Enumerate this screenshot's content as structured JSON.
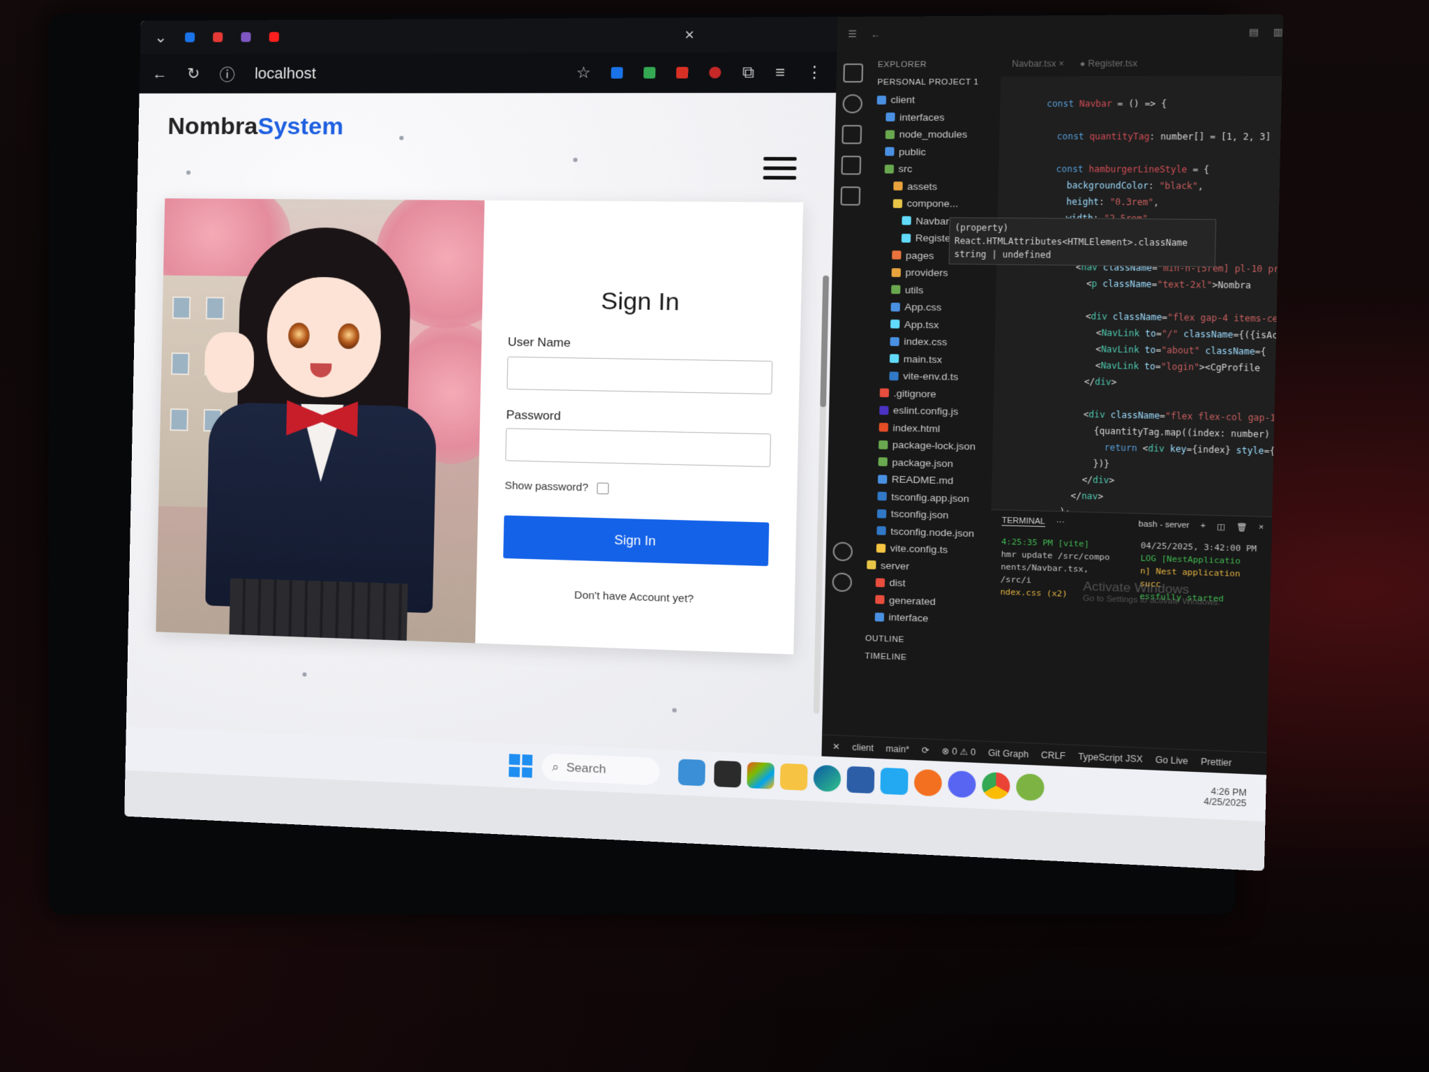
{
  "browser": {
    "url": "localhost",
    "tab_close": "×"
  },
  "site": {
    "brand_main": "Nombra",
    "brand_accent": "System",
    "accent_color": "#1d5fe0"
  },
  "signin": {
    "title": "Sign In",
    "username_label": "User Name",
    "username_value": "",
    "password_label": "Password",
    "password_value": "",
    "show_password_label": "Show password?",
    "show_password_checked": false,
    "submit_label": "Sign In",
    "submit_color": "#1462e8",
    "account_link": "Don't have Account yet?"
  },
  "vscode": {
    "explorer_title": "EXPLORER",
    "project_name": "PERSONAL PROJECT 1",
    "tree": [
      {
        "label": "client",
        "depth": 0,
        "icon": "folder-icon",
        "color": "#4a90e2"
      },
      {
        "label": "interfaces",
        "depth": 1,
        "icon": "folder-icon",
        "color": "#4a90e2"
      },
      {
        "label": "node_modules",
        "depth": 1,
        "icon": "folder-icon",
        "color": "#6aa84f"
      },
      {
        "label": "public",
        "depth": 1,
        "icon": "folder-icon",
        "color": "#4a90e2"
      },
      {
        "label": "src",
        "depth": 1,
        "icon": "folder-icon",
        "color": "#6aa84f"
      },
      {
        "label": "assets",
        "depth": 2,
        "icon": "folder-icon",
        "color": "#e8a33d"
      },
      {
        "label": "compone...",
        "depth": 2,
        "icon": "folder-icon",
        "color": "#e8c547"
      },
      {
        "label": "Navbar...",
        "depth": 3,
        "icon": "react-icon",
        "color": "#61dafb"
      },
      {
        "label": "Register.tsx",
        "depth": 3,
        "icon": "react-icon",
        "color": "#61dafb"
      },
      {
        "label": "pages",
        "depth": 2,
        "icon": "folder-icon",
        "color": "#e8733d"
      },
      {
        "label": "providers",
        "depth": 2,
        "icon": "folder-icon",
        "color": "#e8a33d"
      },
      {
        "label": "utils",
        "depth": 2,
        "icon": "folder-icon",
        "color": "#6aa84f"
      },
      {
        "label": "App.css",
        "depth": 2,
        "icon": "css-icon",
        "color": "#4a90e2"
      },
      {
        "label": "App.tsx",
        "depth": 2,
        "icon": "react-icon",
        "color": "#61dafb"
      },
      {
        "label": "index.css",
        "depth": 2,
        "icon": "css-icon",
        "color": "#4a90e2"
      },
      {
        "label": "main.tsx",
        "depth": 2,
        "icon": "react-icon",
        "color": "#61dafb"
      },
      {
        "label": "vite-env.d.ts",
        "depth": 2,
        "icon": "ts-icon",
        "color": "#3178c6"
      },
      {
        "label": ".gitignore",
        "depth": 1,
        "icon": "git-icon",
        "color": "#e84d3d"
      },
      {
        "label": "eslint.config.js",
        "depth": 1,
        "icon": "eslint-icon",
        "color": "#4b32c3"
      },
      {
        "label": "index.html",
        "depth": 1,
        "icon": "html-icon",
        "color": "#e44d26"
      },
      {
        "label": "package-lock.json",
        "depth": 1,
        "icon": "npm-icon",
        "color": "#6aa84f"
      },
      {
        "label": "package.json",
        "depth": 1,
        "icon": "npm-icon",
        "color": "#6aa84f"
      },
      {
        "label": "README.md",
        "depth": 1,
        "icon": "info-icon",
        "color": "#4a90e2"
      },
      {
        "label": "tsconfig.app.json",
        "depth": 1,
        "icon": "ts-icon",
        "color": "#3178c6"
      },
      {
        "label": "tsconfig.json",
        "depth": 1,
        "icon": "ts-icon",
        "color": "#3178c6"
      },
      {
        "label": "tsconfig.node.json",
        "depth": 1,
        "icon": "ts-icon",
        "color": "#3178c6"
      },
      {
        "label": "vite.config.ts",
        "depth": 1,
        "icon": "vite-icon",
        "color": "#f5c542"
      },
      {
        "label": "server",
        "depth": 0,
        "icon": "folder-icon",
        "color": "#e8c547"
      },
      {
        "label": "dist",
        "depth": 1,
        "icon": "folder-icon",
        "color": "#e84d3d"
      },
      {
        "label": "generated",
        "depth": 1,
        "icon": "folder-icon",
        "color": "#e84d3d"
      },
      {
        "label": "interface",
        "depth": 1,
        "icon": "folder-icon",
        "color": "#4a90e2"
      }
    ],
    "outline_label": "OUTLINE",
    "timeline_label": "TIMELINE",
    "hover_line1": "(property) React.HTMLAttributes<HTMLElement>.className",
    "hover_line2": "string | undefined",
    "terminal_tab": "TERMINAL",
    "terminal_shell": "bash - server",
    "terminal_line1": "4:25:35 PM [vite]",
    "terminal_line2": "hmr update /src/compo",
    "terminal_line3": "nents/Navbar.tsx, /src/i",
    "terminal_line4": "ndex.css (x2)",
    "terminal_right1": "04/25/2025, 3:42:00 PM",
    "terminal_right2": "LOG [NestApplicatio",
    "terminal_right3": "n] Nest application succ",
    "terminal_right4": "essfully started",
    "watermark_title": "Activate Windows",
    "watermark_sub": "Go to Settings to activate Windows.",
    "status_branch": "main*",
    "status_client": "client",
    "status_errors": "0",
    "status_warnings": "0",
    "status_gitgraph": "Git Graph",
    "status_eol": "CRLF",
    "status_lang": "TypeScript JSX",
    "status_golive": "Go Live",
    "status_prettier": "Prettier"
  },
  "taskbar": {
    "search_placeholder": "Search",
    "time": "4:26 PM",
    "date": "4/25/2025"
  }
}
